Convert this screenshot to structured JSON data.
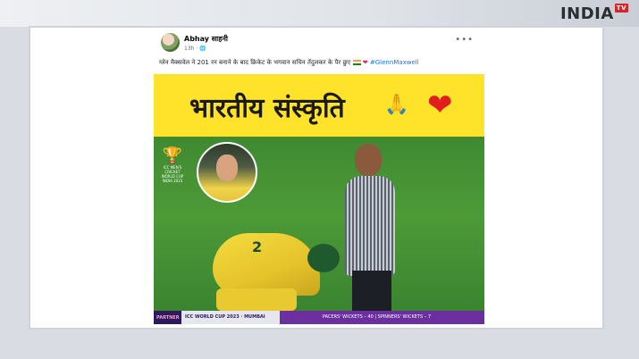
{
  "brand": {
    "name": "INDIA",
    "tv": "TV"
  },
  "post": {
    "author": "Abhay साहनी",
    "time": "13h · ",
    "more": "•••",
    "caption": "ग्लेन मैक्सवेल ने 201 रन बनाने के बाद क्रिकेट के भगवान सचिन तेंदुलकर के पैर छुए ",
    "hashtag": "#GlennMaxwell"
  },
  "image": {
    "banner_text": "भारतीय संस्कृति",
    "hands_emoji": "🙏",
    "heart": "❤",
    "wc_logo_text": "ICC MEN'S CRICKET WORLD CUP INDIA 2023",
    "player_number": "2",
    "ticker_left": "PARTNER",
    "ticker_mid": "ICC WORLD CUP 2023 · MUMBAI",
    "ticker_right": "PACERS' WICKETS – 40 | SPINNERS' WICKETS – 7"
  },
  "colors": {
    "banner": "#ffe32a",
    "heart": "#e11d1d",
    "hashtag": "#1877f2",
    "ticker": "#2c1a5c"
  }
}
